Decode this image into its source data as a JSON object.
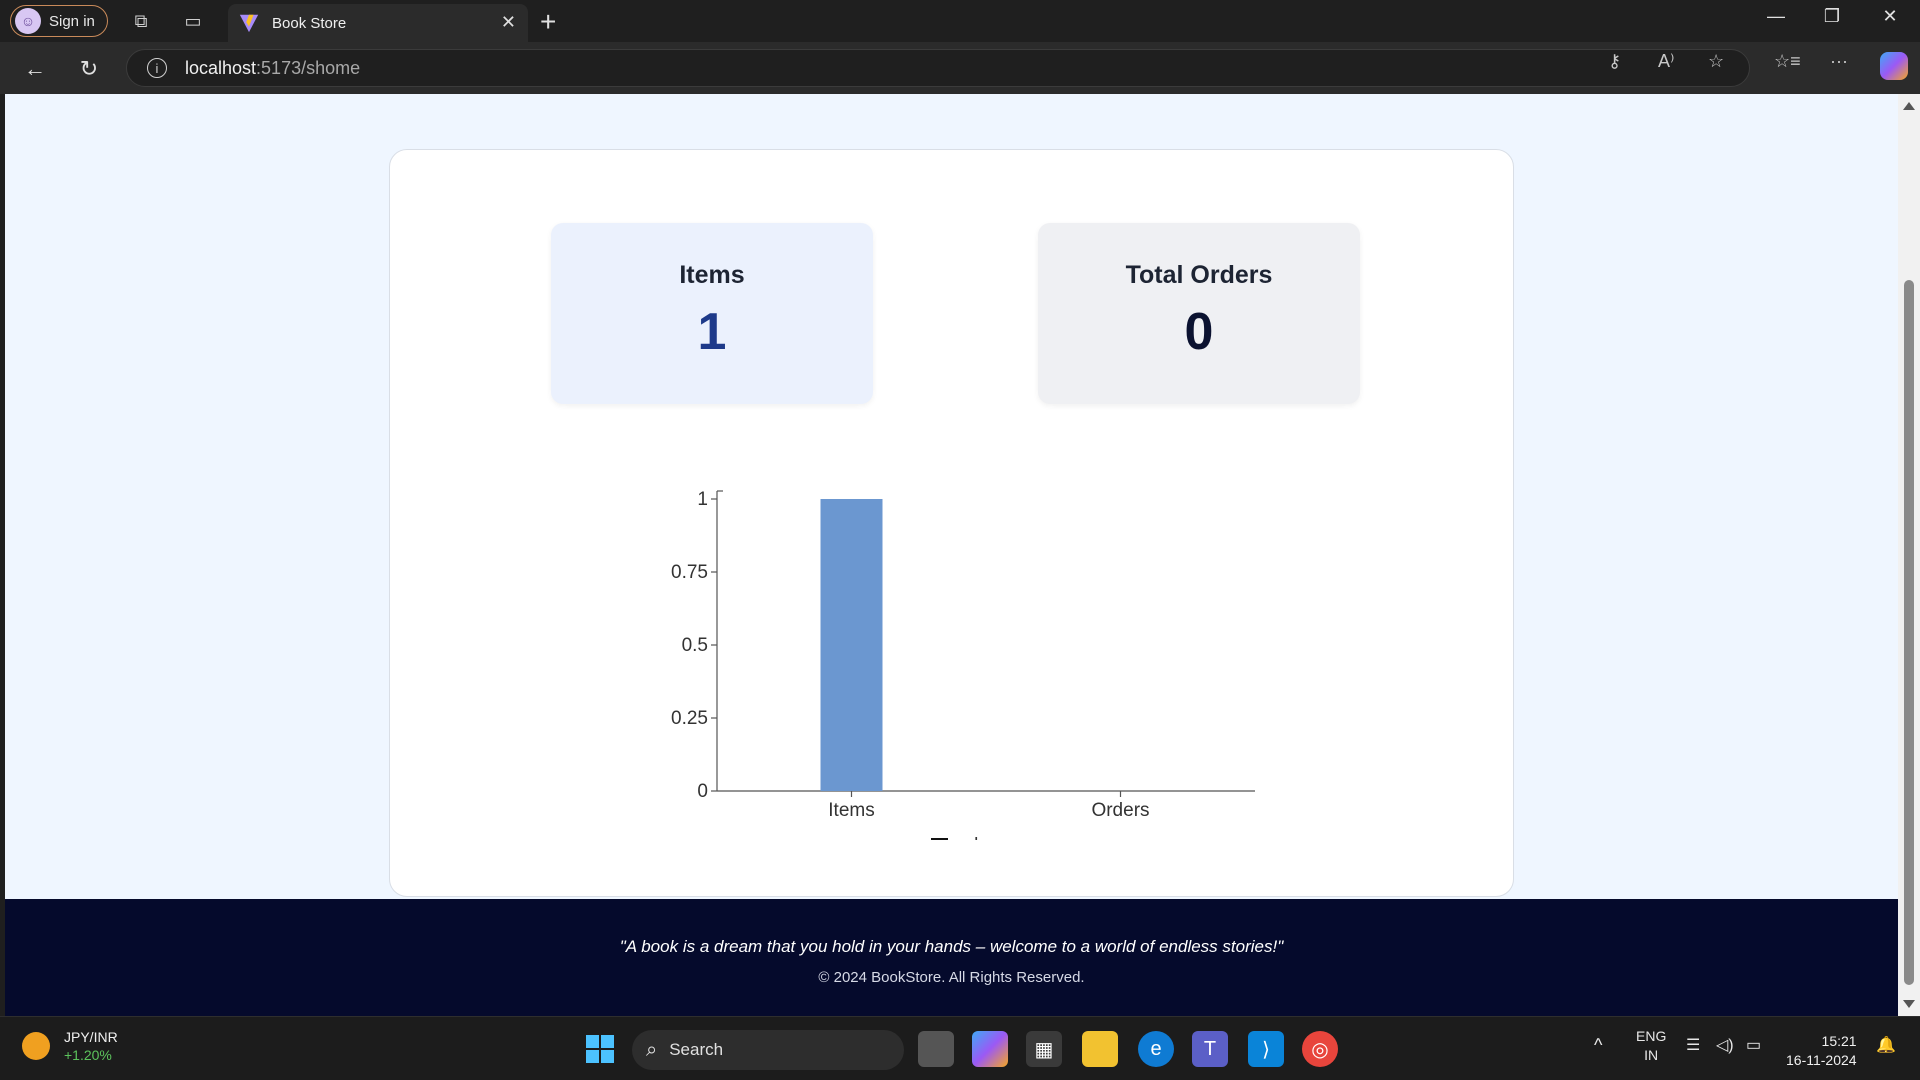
{
  "browser": {
    "signin_label": "Sign in",
    "tab_title": "Book Store",
    "url_host": "localhost",
    "url_rest": ":5173/shome"
  },
  "stats": {
    "items_label": "Items",
    "items_value": "1",
    "orders_label": "Total Orders",
    "orders_value": "0"
  },
  "chart_data": {
    "type": "bar",
    "categories": [
      "Items",
      "Orders"
    ],
    "series": [
      {
        "name": "value",
        "values": [
          1,
          0
        ],
        "color": "#6b97d0"
      }
    ],
    "ylim": [
      0,
      1
    ],
    "yticks": [
      "0",
      "0.25",
      "0.5",
      "0.75",
      "1"
    ],
    "ytick_values": [
      0,
      0.25,
      0.5,
      0.75,
      1
    ],
    "legend": "bottom",
    "grid": false
  },
  "footer": {
    "quote": "\"A book is a dream that you hold in your hands – welcome to a world of endless stories!\"",
    "copyright": "© 2024 BookStore. All Rights Reserved."
  },
  "taskbar": {
    "ticker_pair": "JPY/INR",
    "ticker_change": "+1.20%",
    "search_label": "Search",
    "lang_top": "ENG",
    "lang_bottom": "IN",
    "time": "15:21",
    "date": "16-11-2024"
  }
}
